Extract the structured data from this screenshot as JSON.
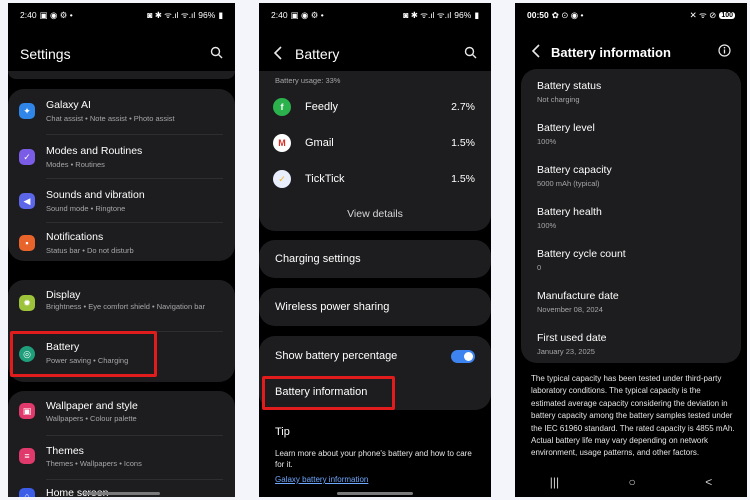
{
  "phone1": {
    "status": {
      "time": "2:40",
      "left_icons": "▣ ◉ ⚙ •",
      "right_icons": "◙ ✱ ᯤ.ıl ᯤ.ıl",
      "battery": "96%"
    },
    "title": "Settings",
    "groups": [
      [
        {
          "title": "Galaxy AI",
          "subtitle": "Chat assist • Note assist • Photo assist",
          "icon": "ai-icon",
          "color": "#2f86e8",
          "glyph": "✦"
        },
        {
          "title": "Modes and Routines",
          "subtitle": "Modes • Routines",
          "icon": "modes-icon",
          "color": "#7b5ce6",
          "glyph": "✓"
        },
        {
          "title": "Sounds and vibration",
          "subtitle": "Sound mode • Ringtone",
          "icon": "sound-icon",
          "color": "#5b66e8",
          "glyph": "◀"
        },
        {
          "title": "Notifications",
          "subtitle": "Status bar • Do not disturb",
          "icon": "notification-icon",
          "color": "#e8642b",
          "glyph": "▪"
        }
      ],
      [
        {
          "title": "Display",
          "subtitle": "Brightness • Eye comfort shield • Navigation bar",
          "icon": "display-icon",
          "color": "#9cc33a",
          "glyph": "✹"
        },
        {
          "title": "Battery",
          "subtitle": "Power saving • Charging",
          "icon": "battery-icon",
          "color": "#1e9e7a",
          "glyph": "◎"
        }
      ],
      [
        {
          "title": "Wallpaper and style",
          "subtitle": "Wallpapers • Colour palette",
          "icon": "wallpaper-icon",
          "color": "#e0396b",
          "glyph": "▣"
        },
        {
          "title": "Themes",
          "subtitle": "Themes • Wallpapers • Icons",
          "icon": "themes-icon",
          "color": "#e0396b",
          "glyph": "≡"
        },
        {
          "title": "Home screen",
          "subtitle": "",
          "icon": "home-icon",
          "color": "#3b5de8",
          "glyph": "⌂"
        }
      ]
    ]
  },
  "phone2": {
    "status": {
      "time": "2:40",
      "left_icons": "▣ ◉ ⚙ •",
      "right_icons": "◙ ✱ ᯤ.ıl ᯤ.ıl",
      "battery": "96%"
    },
    "title": "Battery",
    "usage_label": "Battery usage: 33%",
    "apps": [
      {
        "name": "Feedly",
        "pct": "2.7%",
        "color": "#2bb24c",
        "glyph": "f",
        "fg": "#fff"
      },
      {
        "name": "Gmail",
        "pct": "1.5%",
        "color": "#ffffff",
        "glyph": "M",
        "fg": "#d93025"
      },
      {
        "name": "TickTick",
        "pct": "1.5%",
        "color": "#e8eefc",
        "glyph": "✓",
        "fg": "#f2b01e"
      }
    ],
    "view_details": "View details",
    "charging_settings": "Charging settings",
    "wireless_power_sharing": "Wireless power sharing",
    "show_battery_percentage": "Show battery percentage",
    "battery_information": "Battery information",
    "tip_title": "Tip",
    "tip_text": "Learn more about your phone's battery and how to care for it.",
    "tip_link": "Galaxy battery information"
  },
  "phone3": {
    "status": {
      "time": "00:50",
      "left_icons": "✿ ⊙ ◉ •",
      "right_icons": "✕ ᯤ ⊘",
      "battery": "100"
    },
    "title": "Battery information",
    "items": [
      {
        "title": "Battery status",
        "value": "Not charging"
      },
      {
        "title": "Battery level",
        "value": "100%"
      },
      {
        "title": "Battery capacity",
        "value": "5000 mAh (typical)"
      },
      {
        "title": "Battery health",
        "value": "100%"
      },
      {
        "title": "Battery cycle count",
        "value": "0"
      },
      {
        "title": "Manufacture date",
        "value": "November 08, 2024"
      },
      {
        "title": "First used date",
        "value": "January 23, 2025"
      }
    ],
    "disclaimer": "The typical capacity has been tested under third-party laboratory conditions. The typical capacity is the estimated average capacity considering the deviation in battery capacity among the battery samples tested under the IEC 61960 standard. The rated capacity is 4855 mAh. Actual battery life may vary depending on network environment, usage patterns, and other factors.",
    "nav": {
      "recents": "|||",
      "home": "○",
      "back": "<"
    }
  },
  "colors": {
    "highlight": "#e01c1c",
    "toggle_on": "#3e84f0",
    "link": "#6fa8ff",
    "card_bg": "#1d1d1f"
  }
}
